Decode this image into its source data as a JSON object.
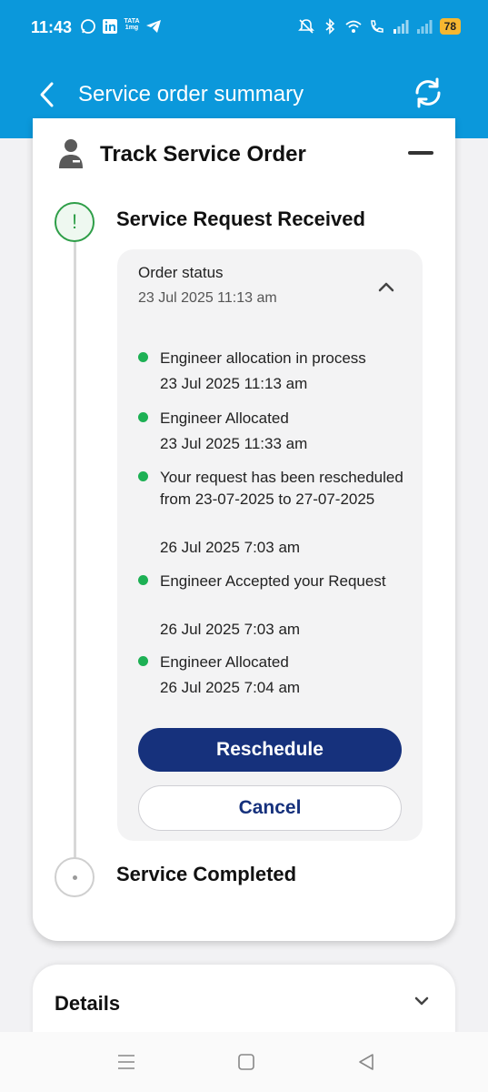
{
  "status_bar": {
    "time": "11:43",
    "tata_label": "TATA 1mg",
    "battery": "78",
    "icons_left": [
      "whatsapp-icon",
      "linkedin-icon",
      "tata-1mg-icon",
      "telegram-icon"
    ],
    "icons_right": [
      "mute-icon",
      "bluetooth-icon",
      "wifi-icon",
      "volte-icon",
      "signal-icon",
      "signal-icon",
      "battery-icon"
    ]
  },
  "app_bar": {
    "title": "Service order summary",
    "back_icon": "chevron-left-icon",
    "refresh_icon": "refresh-icon",
    "background": "#0b98db"
  },
  "track": {
    "title": "Track Service Order",
    "steps": [
      {
        "title": "Service Request Received",
        "status": "active",
        "icon": "exclamation-icon",
        "color": "#2e9e48"
      },
      {
        "title": "Service Completed",
        "status": "pending"
      }
    ],
    "order_status": {
      "label": "Order status",
      "date": "23 Jul 2025 11:13 am",
      "events": [
        {
          "text": "Engineer allocation in process",
          "time": "23 Jul 2025 11:13 am"
        },
        {
          "text": "Engineer Allocated",
          "time": "23 Jul 2025 11:33 am"
        },
        {
          "text": "Your request has been rescheduled from 23-07-2025 to 27-07-2025",
          "time": "26 Jul 2025 7:03 am"
        },
        {
          "text": "Engineer Accepted your Request",
          "time": "26 Jul 2025 7:03 am"
        },
        {
          "text": "Engineer Allocated",
          "time": "26 Jul 2025 7:04 am"
        }
      ],
      "dot_color": "#1db054"
    },
    "buttons": {
      "reschedule": "Reschedule",
      "cancel": "Cancel",
      "primary_color": "#16317c"
    }
  },
  "details": {
    "title": "Details"
  },
  "nav": {
    "items": [
      "menu-icon",
      "home-square-icon",
      "back-triangle-icon"
    ]
  }
}
